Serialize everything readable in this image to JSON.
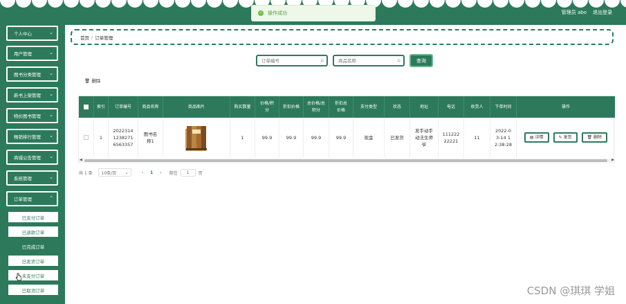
{
  "header": {
    "user": "管理员 abo",
    "logout": "退出登录"
  },
  "toast": {
    "message": "操作成功"
  },
  "sidebar": {
    "menus": [
      "个人中心",
      "用户管理",
      "图书分类管理",
      "新书上架管理",
      "特价图书管理",
      "畅销排行管理",
      "商城公告管理",
      "系统管理",
      "订单管理"
    ],
    "submenus": [
      "已支付订单",
      "已退款订单",
      "已完成订单",
      "已发货订单",
      "未支付订单",
      "已取消订单"
    ]
  },
  "breadcrumb": {
    "home": "首页",
    "current": "订单管理"
  },
  "search": {
    "order_no_placeholder": "订单编号",
    "product_placeholder": "商品名称",
    "button": "查询"
  },
  "toolbar": {
    "delete": "删除"
  },
  "table": {
    "headers": [
      "索引",
      "订单编号",
      "商品名称",
      "商品图片",
      "购买数量",
      "价格/积分",
      "折扣价格",
      "总价格/总积分",
      "折扣总价格",
      "支付类型",
      "状态",
      "地址",
      "电话",
      "收货人",
      "下单时间",
      "操作"
    ],
    "rows": [
      {
        "index": "1",
        "order_no": "20223141238271 6563357",
        "product": "图书名称1",
        "qty": "1",
        "price": "99.9",
        "discount_price": "99.9",
        "total": "99.9",
        "discount_total": "99.9",
        "pay_type": "现金",
        "status": "已发货",
        "address": "发手动手动法生师爷",
        "phone": "11122222221",
        "receiver": "11",
        "time": "2022-03-14 12:38:28"
      }
    ],
    "actions": [
      "详情",
      "发货",
      "删除"
    ]
  },
  "pager": {
    "total": "共 1 条",
    "size": "10条/页",
    "page": "1",
    "goto": "前往",
    "goto_value": "1",
    "page_unit": "页"
  },
  "watermark": "CSDN @琪琪 学姐",
  "colors": {
    "primary": "#2c7a5b"
  }
}
